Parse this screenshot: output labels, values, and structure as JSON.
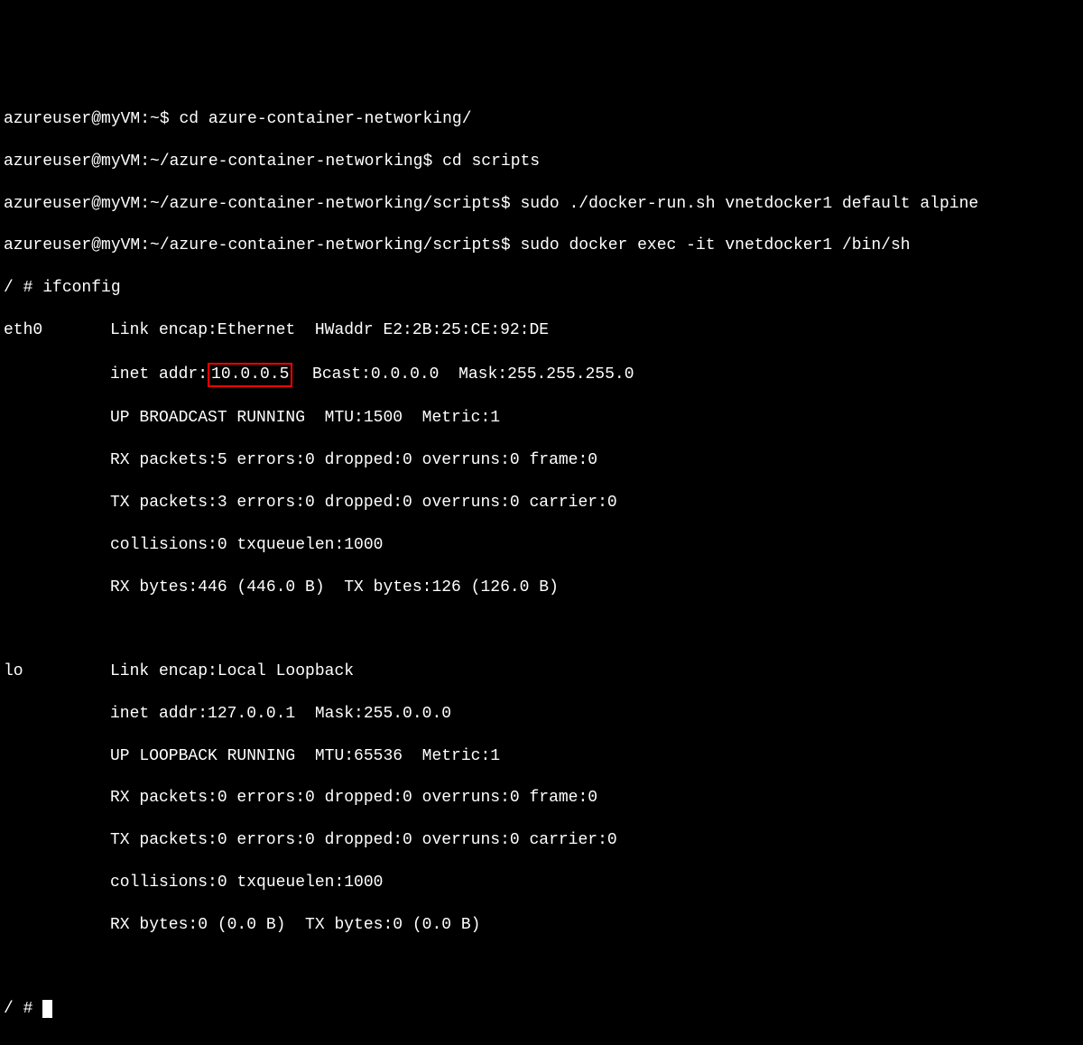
{
  "prompt1": "azureuser@myVM:~$ ",
  "cmd1": "cd azure-container-networking/",
  "prompt2": "azureuser@myVM:~/azure-container-networking$ ",
  "cmd2": "cd scripts",
  "prompt3": "azureuser@myVM:~/azure-container-networking/scripts$ ",
  "cmd3": "sudo ./docker-run.sh vnetdocker1 default alpine",
  "prompt4": "azureuser@myVM:~/azure-container-networking/scripts$ ",
  "cmd4": "sudo docker exec -it vnetdocker1 /bin/sh",
  "shell_prompt": "/ # ",
  "cmd5": "ifconfig",
  "eth0": {
    "name": "eth0",
    "l1": "Link encap:Ethernet  HWaddr E2:2B:25:CE:92:DE",
    "inet_prefix": "inet addr:",
    "inet_addr": "10.0.0.5",
    "inet_suffix": "  Bcast:0.0.0.0  Mask:255.255.255.0",
    "l3": "UP BROADCAST RUNNING  MTU:1500  Metric:1",
    "l4": "RX packets:5 errors:0 dropped:0 overruns:0 frame:0",
    "l5": "TX packets:3 errors:0 dropped:0 overruns:0 carrier:0",
    "l6": "collisions:0 txqueuelen:1000",
    "l7": "RX bytes:446 (446.0 B)  TX bytes:126 (126.0 B)"
  },
  "lo": {
    "name": "lo",
    "l1": "Link encap:Local Loopback",
    "l2": "inet addr:127.0.0.1  Mask:255.0.0.0",
    "l3": "UP LOOPBACK RUNNING  MTU:65536  Metric:1",
    "l4": "RX packets:0 errors:0 dropped:0 overruns:0 frame:0",
    "l5": "TX packets:0 errors:0 dropped:0 overruns:0 carrier:0",
    "l6": "collisions:0 txqueuelen:1000",
    "l7": "RX bytes:0 (0.0 B)  TX bytes:0 (0.0 B)"
  },
  "final_prompt": "/ # "
}
